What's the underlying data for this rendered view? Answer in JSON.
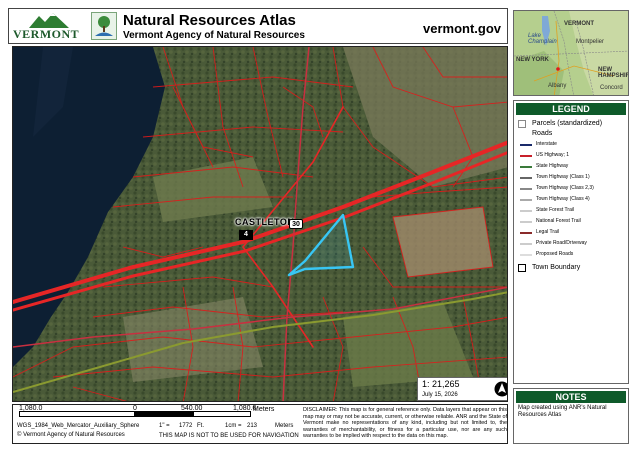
{
  "header": {
    "vermont_logo_text": "VERMONT",
    "title": "Natural Resources Atlas",
    "subtitle": "Vermont Agency of Natural Resources",
    "website": "vermont.gov"
  },
  "map": {
    "town_label": "CASTLETON",
    "shields": {
      "us_route": "30",
      "state_route": "4"
    },
    "scale_ratio": "1:  21,265",
    "date": "July 15, 2026",
    "colors": {
      "parcels": "#e01a1a",
      "interstate": "#e62626",
      "state_highway": "#7a8a2a",
      "selection": "#38c6f4",
      "water": "#0d1f33"
    }
  },
  "overview": {
    "labels": [
      "VERMONT",
      "Montpelier",
      "Lake Champlain",
      "NEW YORK",
      "Albany",
      "NEW HAMPSHIRE",
      "Concord"
    ]
  },
  "legend": {
    "title": "LEGEND",
    "parcels": "Parcels (standardized)",
    "roads_heading": "Roads",
    "roads": [
      {
        "label": "Interstate",
        "color": "#1a2a6a"
      },
      {
        "label": "US Highway; 1",
        "color": "#c8202a"
      },
      {
        "label": "State Highway",
        "color": "#3a7a3a"
      },
      {
        "label": "Town Highway (Class 1)",
        "color": "#666666"
      },
      {
        "label": "Town Highway (Class 2,3)",
        "color": "#888888"
      },
      {
        "label": "Town Highway (Class 4)",
        "color": "#aaaaaa"
      },
      {
        "label": "State Forest Trail",
        "color": "#cccccc"
      },
      {
        "label": "National Forest Trail",
        "color": "#cccccc"
      },
      {
        "label": "Legal Trail",
        "color": "#8a2a2a"
      },
      {
        "label": "Private Road/Driveway",
        "color": "#cccccc"
      },
      {
        "label": "Proposed Roads",
        "color": "#dddddd"
      }
    ],
    "town_boundary": "Town Boundary"
  },
  "notes": {
    "title": "NOTES",
    "text": "Map created using ANR's Natural Resources Atlas"
  },
  "scalebar": {
    "left_value": "1,080.0",
    "zero": "0",
    "mid_value": "540.00",
    "right_value": "1,080.0",
    "unit": "Meters",
    "projection": "WGS_1984_Web_Mercator_Auxiliary_Sphere",
    "copyright": "© Vermont Agency of Natural Resources",
    "conversion_inch": "1\" =",
    "conversion_inch_value": "1772",
    "conversion_inch_unit": "Ft.",
    "conversion_cm": "1cm =",
    "conversion_cm_value": "213",
    "conversion_cm_unit": "Meters",
    "nav_warning": "THIS MAP IS NOT TO BE USED FOR NAVIGATION"
  },
  "disclaimer": "DISCLAIMER: This map is for general reference only. Data layers that appear on this map may or may not be accurate, current, or otherwise reliable. ANR and the State of Vermont make no representations of any kind, including but not limited to, the warranties of merchantability, or fitness for a particular use, nor are any such warranties to be implied with respect to the data on this map."
}
